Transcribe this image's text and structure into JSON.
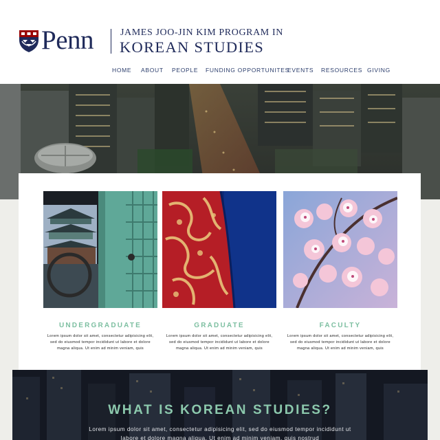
{
  "brand": {
    "wordmark": "Penn",
    "program_line1": "JAMES JOO-JIN KIM PROGRAM IN",
    "program_line2": "KOREAN STUDIES"
  },
  "nav": [
    {
      "label": "HOME"
    },
    {
      "label": "ABOUT"
    },
    {
      "label": "PEOPLE"
    },
    {
      "label": "FUNDING OPPORTUNITES"
    },
    {
      "label": "EVENTS"
    },
    {
      "label": "RESOURCES"
    },
    {
      "label": "GIVING"
    }
  ],
  "columns": [
    {
      "title": "UNDERGRADUATE",
      "text": "Lorem ipsum dolor sit amet, consectetur adipisicing elit, sed do eiusmod tempor incididunt ut labore et dolore magna aliqua. Ut enim ad minim veniam, quis"
    },
    {
      "title": "GRADUATE",
      "text": "Lorem ipsum dolor sit amet, consectetur adipisicing elit, sed do eiusmod tempor incididunt ut labore et dolore magna aliqua. Ut enim ad minim veniam, quis"
    },
    {
      "title": "FACULTY",
      "text": "Lorem ipsum dolor sit amet, consectetur adipisicing elit, sed do eiusmod tempor incididunt ut labore et dolore magna aliqua. Ut enim ad minim veniam, quis"
    }
  ],
  "section": {
    "title": "WHAT IS KOREAN STUDIES?",
    "body": "Lorem ipsum dolor sit amet, consectetur adipisicing elit, sed do eiusmod tempor incididunt ut labore et dolore magna aliqua. Ut enim ad minim veniam, quis nostrud"
  },
  "colors": {
    "penn_blue": "#1f2a5a",
    "penn_red": "#990000",
    "accent_green": "#7dbfa1",
    "page_background": "#eeeeea"
  },
  "icons": {
    "shield": "penn-shield-icon"
  }
}
